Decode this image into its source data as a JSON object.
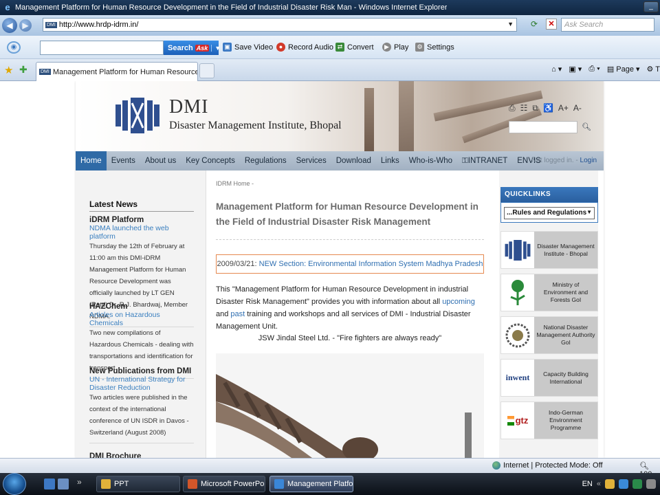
{
  "window": {
    "title": "Management Platform for Human Resource Development in the Field of Industrial Disaster Risk Man - Windows Internet Explorer"
  },
  "address_bar": {
    "url": "http://www.hrdp-idrm.in/",
    "favicon_text": "DMI",
    "search_placeholder": "Ask Search"
  },
  "ask_toolbar": {
    "search_label": "Search",
    "ask_logo": "Ask",
    "tools": [
      {
        "label": "Save Video",
        "icon": "save-video-icon",
        "color": "#3b79c4"
      },
      {
        "label": "Record Audio",
        "icon": "record-icon",
        "color": "#d23a2a"
      },
      {
        "label": "Convert",
        "icon": "convert-icon",
        "color": "#3a8a3a"
      },
      {
        "label": "Play",
        "icon": "play-icon",
        "color": "#888888"
      },
      {
        "label": "Settings",
        "icon": "settings-icon",
        "color": "#888888"
      }
    ]
  },
  "tabs": {
    "active_tab": "Management Platform for Human Resource Dev...",
    "favicon_text": "DMI",
    "commands": [
      "Page",
      "T"
    ]
  },
  "site": {
    "brand": "DMI",
    "institute": "Disaster Management Institute, Bhopal",
    "tool_icons": [
      "A+",
      "A-"
    ],
    "nav": [
      "Home",
      "Events",
      "About us",
      "Key Concepts",
      "Regulations",
      "Services",
      "Download",
      "Links",
      "Who-is-Who",
      "INTRANET",
      "ENVIS"
    ],
    "nav_active": 0,
    "login_status": "Not logged in.",
    "login_link": "Login",
    "breadcrumb": "IDRM Home",
    "page_title": "Management Platform for Human Resource Development in the Field of Industrial Disaster Risk Management",
    "notice_date": "2009/03/21:",
    "notice_text": "NEW Section: Environmental Information System Madhya Pradesh",
    "intro_a": "This \"Management Platform for Human Resource Development in industrial Disaster Risk Management\" provides you with information about all",
    "intro_upcoming": "upcoming",
    "intro_and": "and",
    "intro_past": "past",
    "intro_b": "training and workshops and all services of DMI - Industrial Disaster Management Unit.",
    "caption": "JSW Jindal Steel Ltd. - \"Fire fighters are always ready\"",
    "latest_news_heading": "Latest News",
    "news": [
      {
        "title": "iDRM Platform",
        "link": "NDMA launched the web platform",
        "body": "Thursday the 12th of February at 11:00 am this DMI-iDRM Management Platform for Human Resource Development was officially launched by LT GEN (Retd) Dr. R.J. Bhardwaj, Member NDMA."
      },
      {
        "title": "HAZChem",
        "link": "Articles on Hazardous Chemicals",
        "body": "Two new compilations of Hazardous Chemicals - dealing with transportations and identification for transport."
      },
      {
        "title": "New Publications from DMI",
        "link": "UN - International Strategy for Disaster Reduction",
        "body": "Two articles were published in the context of the international conference of UN ISDR in Davos - Switzerland (August 2008)"
      },
      {
        "title": "DMI Brochure",
        "link": "",
        "body": ""
      }
    ],
    "quicklinks_heading": "QUICKLINKS",
    "quicklinks_selected": "...Rules and Regulations",
    "partners": [
      {
        "name": "Disaster Management Institute - Bhopal",
        "logo": "dmi-logo-icon"
      },
      {
        "name": "Ministry of Environment and Forests GoI",
        "logo": "moef-logo-icon"
      },
      {
        "name": "National Disaster Management Authority GoI",
        "logo": "ndma-logo-icon"
      },
      {
        "name": "Capacity Building International",
        "logo": "invent-logo-icon",
        "logo_text": "inwent"
      },
      {
        "name": "Indo-German Environment Programme",
        "logo": "gtz-logo-icon",
        "logo_text": "gtz"
      }
    ]
  },
  "status_bar": {
    "zone": "Internet | Protected Mode: Off",
    "zoom": "100"
  },
  "taskbar": {
    "buttons": [
      {
        "label": "PPT",
        "icon": "folder-icon",
        "color": "#e0b13a"
      },
      {
        "label": "Microsoft PowerPoi...",
        "icon": "powerpoint-icon",
        "color": "#d2562a"
      },
      {
        "label": "Management Platfo...",
        "icon": "ie-icon",
        "color": "#3a86d8"
      }
    ],
    "lang": "EN"
  }
}
